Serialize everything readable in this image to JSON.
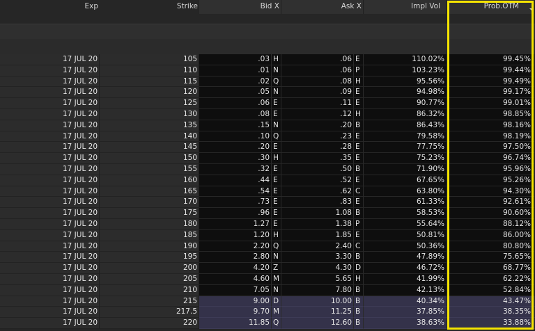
{
  "columns": {
    "exp": "Exp",
    "strike": "Strike",
    "bid": "Bid X",
    "ask": "Ask X",
    "impl_vol": "Impl Vol",
    "prob_otm": "Prob.OTM"
  },
  "colors": {
    "highlight": "#f5e400",
    "selected_row": "#34324a"
  },
  "rows": [
    {
      "exp": "17 JUL 20",
      "strike": "105",
      "bid": ".03",
      "bid_x": "H",
      "ask": ".06",
      "ask_x": "E",
      "iv": "110.02%",
      "prob": "99.45%"
    },
    {
      "exp": "17 JUL 20",
      "strike": "110",
      "bid": ".01",
      "bid_x": "N",
      "ask": ".06",
      "ask_x": "P",
      "iv": "103.23%",
      "prob": "99.44%"
    },
    {
      "exp": "17 JUL 20",
      "strike": "115",
      "bid": ".02",
      "bid_x": "Q",
      "ask": ".08",
      "ask_x": "H",
      "iv": "95.56%",
      "prob": "99.49%"
    },
    {
      "exp": "17 JUL 20",
      "strike": "120",
      "bid": ".05",
      "bid_x": "N",
      "ask": ".09",
      "ask_x": "E",
      "iv": "94.98%",
      "prob": "99.17%"
    },
    {
      "exp": "17 JUL 20",
      "strike": "125",
      "bid": ".06",
      "bid_x": "E",
      "ask": ".11",
      "ask_x": "E",
      "iv": "90.77%",
      "prob": "99.01%"
    },
    {
      "exp": "17 JUL 20",
      "strike": "130",
      "bid": ".08",
      "bid_x": "E",
      "ask": ".12",
      "ask_x": "H",
      "iv": "86.32%",
      "prob": "98.85%"
    },
    {
      "exp": "17 JUL 20",
      "strike": "135",
      "bid": ".15",
      "bid_x": "N",
      "ask": ".20",
      "ask_x": "B",
      "iv": "86.43%",
      "prob": "98.16%"
    },
    {
      "exp": "17 JUL 20",
      "strike": "140",
      "bid": ".10",
      "bid_x": "Q",
      "ask": ".23",
      "ask_x": "E",
      "iv": "79.58%",
      "prob": "98.19%"
    },
    {
      "exp": "17 JUL 20",
      "strike": "145",
      "bid": ".20",
      "bid_x": "E",
      "ask": ".28",
      "ask_x": "E",
      "iv": "77.75%",
      "prob": "97.50%"
    },
    {
      "exp": "17 JUL 20",
      "strike": "150",
      "bid": ".30",
      "bid_x": "H",
      "ask": ".35",
      "ask_x": "E",
      "iv": "75.23%",
      "prob": "96.74%"
    },
    {
      "exp": "17 JUL 20",
      "strike": "155",
      "bid": ".32",
      "bid_x": "E",
      "ask": ".50",
      "ask_x": "B",
      "iv": "71.90%",
      "prob": "95.96%"
    },
    {
      "exp": "17 JUL 20",
      "strike": "160",
      "bid": ".44",
      "bid_x": "E",
      "ask": ".52",
      "ask_x": "E",
      "iv": "67.65%",
      "prob": "95.26%"
    },
    {
      "exp": "17 JUL 20",
      "strike": "165",
      "bid": ".54",
      "bid_x": "E",
      "ask": ".62",
      "ask_x": "C",
      "iv": "63.80%",
      "prob": "94.30%"
    },
    {
      "exp": "17 JUL 20",
      "strike": "170",
      "bid": ".73",
      "bid_x": "E",
      "ask": ".83",
      "ask_x": "E",
      "iv": "61.33%",
      "prob": "92.61%"
    },
    {
      "exp": "17 JUL 20",
      "strike": "175",
      "bid": ".96",
      "bid_x": "E",
      "ask": "1.08",
      "ask_x": "B",
      "iv": "58.53%",
      "prob": "90.60%"
    },
    {
      "exp": "17 JUL 20",
      "strike": "180",
      "bid": "1.27",
      "bid_x": "E",
      "ask": "1.38",
      "ask_x": "P",
      "iv": "55.64%",
      "prob": "88.12%"
    },
    {
      "exp": "17 JUL 20",
      "strike": "185",
      "bid": "1.20",
      "bid_x": "H",
      "ask": "1.85",
      "ask_x": "E",
      "iv": "50.81%",
      "prob": "86.00%"
    },
    {
      "exp": "17 JUL 20",
      "strike": "190",
      "bid": "2.20",
      "bid_x": "Q",
      "ask": "2.40",
      "ask_x": "C",
      "iv": "50.36%",
      "prob": "80.80%"
    },
    {
      "exp": "17 JUL 20",
      "strike": "195",
      "bid": "2.80",
      "bid_x": "N",
      "ask": "3.30",
      "ask_x": "B",
      "iv": "47.89%",
      "prob": "75.65%"
    },
    {
      "exp": "17 JUL 20",
      "strike": "200",
      "bid": "4.20",
      "bid_x": "Z",
      "ask": "4.30",
      "ask_x": "D",
      "iv": "46.72%",
      "prob": "68.77%"
    },
    {
      "exp": "17 JUL 20",
      "strike": "205",
      "bid": "4.60",
      "bid_x": "M",
      "ask": "5.65",
      "ask_x": "H",
      "iv": "41.99%",
      "prob": "62.22%"
    },
    {
      "exp": "17 JUL 20",
      "strike": "210",
      "bid": "7.05",
      "bid_x": "N",
      "ask": "7.80",
      "ask_x": "B",
      "iv": "42.13%",
      "prob": "52.84%"
    },
    {
      "exp": "17 JUL 20",
      "strike": "215",
      "bid": "9.00",
      "bid_x": "D",
      "ask": "10.00",
      "ask_x": "B",
      "iv": "40.34%",
      "prob": "43.47%",
      "hl": true
    },
    {
      "exp": "17 JUL 20",
      "strike": "217.5",
      "bid": "9.70",
      "bid_x": "M",
      "ask": "11.25",
      "ask_x": "B",
      "iv": "37.85%",
      "prob": "38.35%",
      "hl": true
    },
    {
      "exp": "17 JUL 20",
      "strike": "220",
      "bid": "11.85",
      "bid_x": "Q",
      "ask": "12.60",
      "ask_x": "B",
      "iv": "38.63%",
      "prob": "33.88%",
      "hl": true
    }
  ]
}
